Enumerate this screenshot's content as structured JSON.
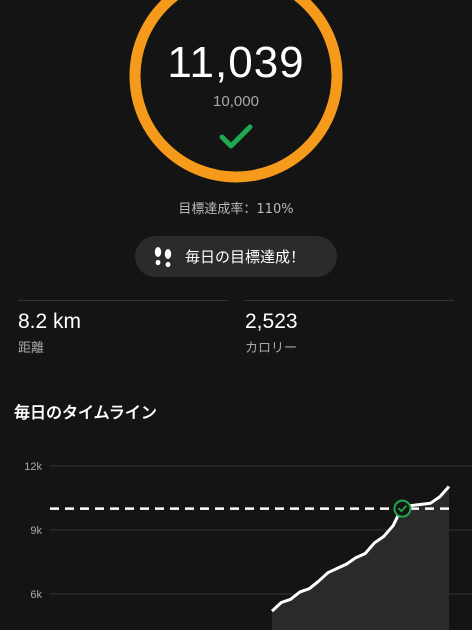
{
  "progress": {
    "steps": "11,039",
    "goal": "10,000",
    "rate_text": "目標達成率：110%",
    "ring_fraction": 1.0,
    "accent_color": "#f59a1b",
    "check_color": "#1fa84f"
  },
  "badge": {
    "icon": "footprints-icon",
    "label": "毎日の目標達成！"
  },
  "stats": {
    "distance": {
      "value": "8.2 km",
      "label": "距離"
    },
    "calories": {
      "value": "2,523",
      "label": "カロリー"
    }
  },
  "timeline": {
    "title": "毎日のタイムライン"
  },
  "chart_data": {
    "type": "area",
    "ytick_labels": [
      "12k",
      "9k",
      "6k"
    ],
    "yticks": [
      12000,
      9000,
      6000
    ],
    "goal_line": 10000,
    "series": [
      {
        "values": [
          5200,
          5600,
          5750,
          6100,
          6250,
          6600,
          7000,
          7200,
          7400,
          7700,
          7900,
          8400,
          8700,
          9200,
          10100,
          10150,
          10200,
          10250,
          10550,
          11039
        ]
      }
    ],
    "goal_marker_index": 14,
    "line_color": "#ffffff",
    "goal_line_color": "#ffffff",
    "marker_color": "#1fa84f"
  }
}
